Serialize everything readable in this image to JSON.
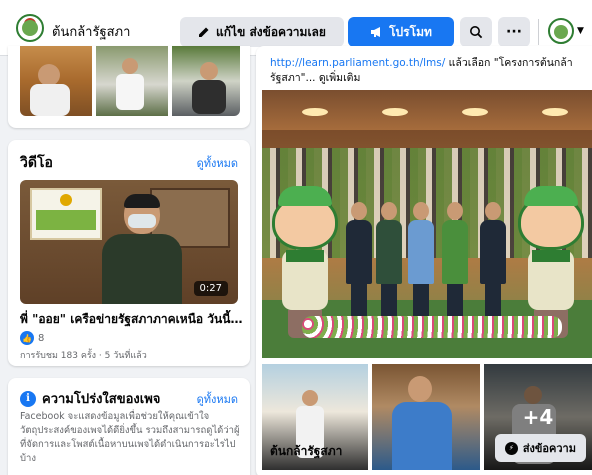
{
  "header": {
    "page_name": "ต้นกล้ารัฐสภา",
    "edit_send_label": "แก้ไข ส่งข้อความเลย",
    "promote_label": "โปรโมท",
    "more_label": "···"
  },
  "icons": {
    "edit": "pencil-icon",
    "promote": "megaphone-icon",
    "search": "search-icon",
    "more": "more-icon",
    "caret": "chevron-down-icon",
    "info": "info-icon",
    "like": "like-icon",
    "messenger": "messenger-icon"
  },
  "colors": {
    "accent": "#1877f2",
    "background": "#f0f2f5",
    "card": "#ffffff",
    "button_gray": "#e4e6eb"
  },
  "videos": {
    "title": "วิดีโอ",
    "see_all": "ดูทั้งหมด",
    "item": {
      "duration": "0:27",
      "title": "พี่ \"ออย\" เครือข่ายรัฐสภาภาคเหนือ วันนี้ม...",
      "reaction_count": "8",
      "meta": "การรับชม 183 ครั้ง · 5 วันที่แล้ว"
    }
  },
  "transparency": {
    "title": "ความโปร่งใสของเพจ",
    "see_all": "ดูทั้งหมด",
    "body": "Facebook จะแสดงข้อมูลเพื่อช่วยให้คุณเข้าใจวัตถุประสงค์ของเพจได้ดียิ่งขึ้น รวมถึงสามารถดูได้ว่าผู้ที่จัดการและโพสต์เนื้อหาบนเพจได้ดำเนินการอะไรไปบ้าง"
  },
  "post": {
    "link_url": "http://learn.parliament.go.th/lms/",
    "link_text": " แล้วเลือก \"โครงการต้นกล้ารัฐสภา\"... ดูเพิ่มเติม",
    "more_photos": "+4",
    "footer_name": "ต้นกล้ารัฐสภา",
    "send_message": "ส่งข้อความ"
  }
}
